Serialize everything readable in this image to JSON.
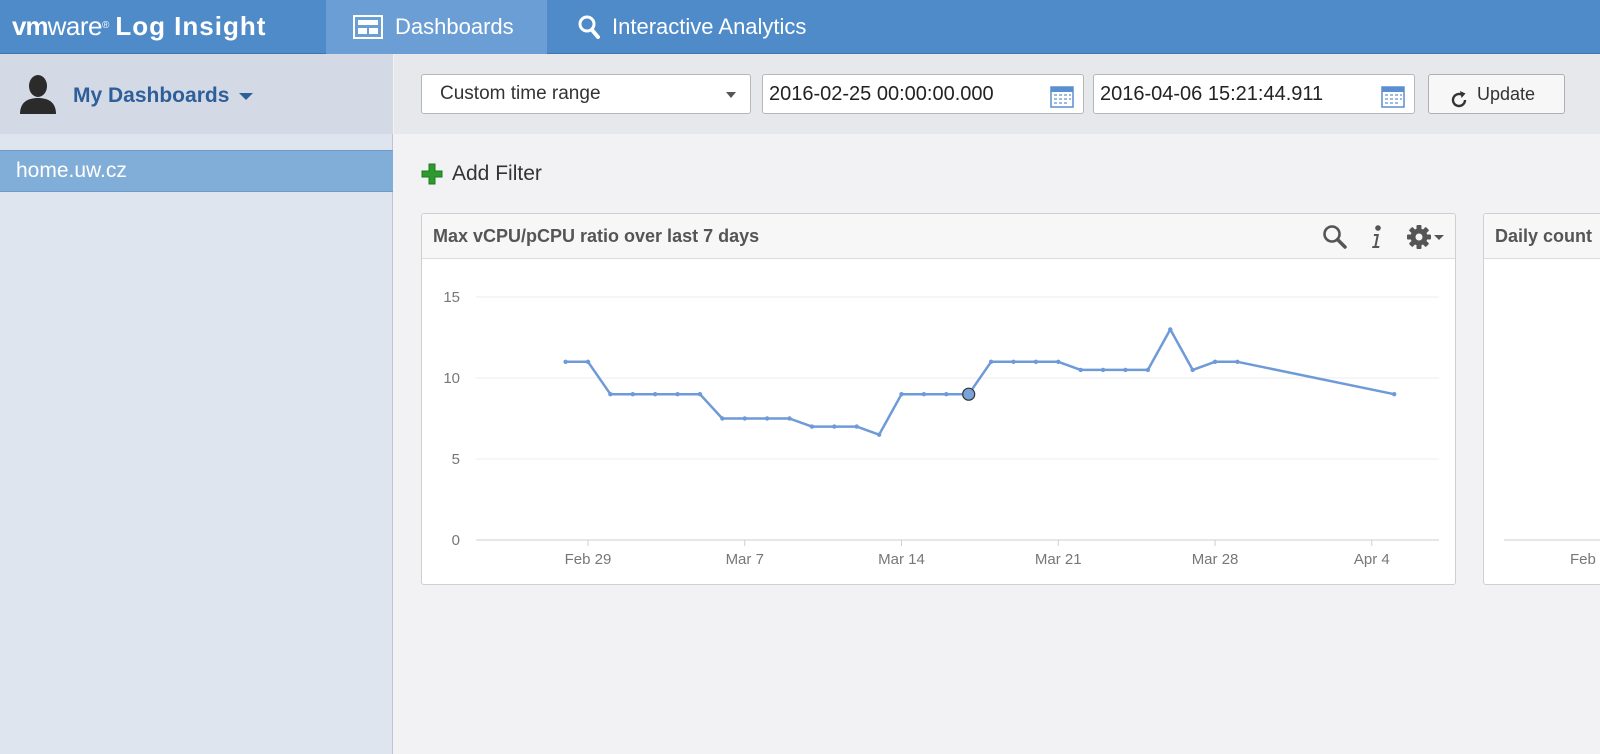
{
  "brand": {
    "vm": "vm",
    "ware": "ware",
    "reg": "®",
    "product": "Log Insight"
  },
  "nav": {
    "dashboards": {
      "label": "Dashboards",
      "icon": "dashboard-icon"
    },
    "analytics": {
      "label": "Interactive Analytics",
      "icon": "search-icon"
    }
  },
  "sidebar": {
    "title": "My Dashboards",
    "items": [
      {
        "label": "home.uw.cz"
      }
    ]
  },
  "toolbar": {
    "time_range": "Custom time range",
    "start": "2016-02-25 00:00:00.000",
    "end": "2016-04-06 15:21:44.911",
    "update_label": "Update"
  },
  "add_filter_label": "Add Filter",
  "colors": {
    "accent": "#4f8bc9",
    "line": "#6f9ad8",
    "plus": "#2e9a2e"
  },
  "widgets": [
    {
      "title": "Max vCPU/pCPU ratio over last 7 days"
    },
    {
      "title": "Daily count"
    }
  ],
  "chart_data": [
    {
      "type": "line",
      "title": "Max vCPU/pCPU ratio over last 7 days",
      "xlabel": "",
      "ylabel": "",
      "ylim": [
        0,
        15
      ],
      "yticks": [
        0,
        5,
        10,
        15
      ],
      "xlim": [
        "2016-02-24",
        "2016-04-07"
      ],
      "xticks": [
        {
          "date": "2016-02-29",
          "label": "Feb 29"
        },
        {
          "date": "2016-03-07",
          "label": "Mar 7"
        },
        {
          "date": "2016-03-14",
          "label": "Mar 14"
        },
        {
          "date": "2016-03-21",
          "label": "Mar 21"
        },
        {
          "date": "2016-03-28",
          "label": "Mar 28"
        },
        {
          "date": "2016-04-04",
          "label": "Apr 4"
        }
      ],
      "grid": true,
      "series": [
        {
          "points": [
            [
              "2016-02-28",
              11
            ],
            [
              "2016-02-29",
              11
            ],
            [
              "2016-03-01",
              9
            ],
            [
              "2016-03-02",
              9
            ],
            [
              "2016-03-03",
              9
            ],
            [
              "2016-03-04",
              9
            ],
            [
              "2016-03-05",
              9
            ],
            [
              "2016-03-06",
              7.5
            ],
            [
              "2016-03-07",
              7.5
            ],
            [
              "2016-03-08",
              7.5
            ],
            [
              "2016-03-09",
              7.5
            ],
            [
              "2016-03-10",
              7
            ],
            [
              "2016-03-11",
              7
            ],
            [
              "2016-03-12",
              7
            ],
            [
              "2016-03-13",
              6.5
            ],
            [
              "2016-03-14",
              9
            ],
            [
              "2016-03-15",
              9
            ],
            [
              "2016-03-16",
              9
            ],
            [
              "2016-03-17",
              9
            ],
            [
              "2016-03-18",
              11
            ],
            [
              "2016-03-19",
              11
            ],
            [
              "2016-03-20",
              11
            ],
            [
              "2016-03-21",
              11
            ],
            [
              "2016-03-22",
              10.5
            ],
            [
              "2016-03-23",
              10.5
            ],
            [
              "2016-03-24",
              10.5
            ],
            [
              "2016-03-25",
              10.5
            ],
            [
              "2016-03-26",
              13
            ],
            [
              "2016-03-27",
              10.5
            ],
            [
              "2016-03-28",
              11
            ],
            [
              "2016-03-29",
              11
            ],
            [
              "2016-04-05",
              9
            ]
          ],
          "highlight": "2016-03-17"
        }
      ]
    },
    {
      "type": "line",
      "title": "Daily count",
      "xticks": [
        {
          "label": "Feb"
        }
      ]
    }
  ]
}
